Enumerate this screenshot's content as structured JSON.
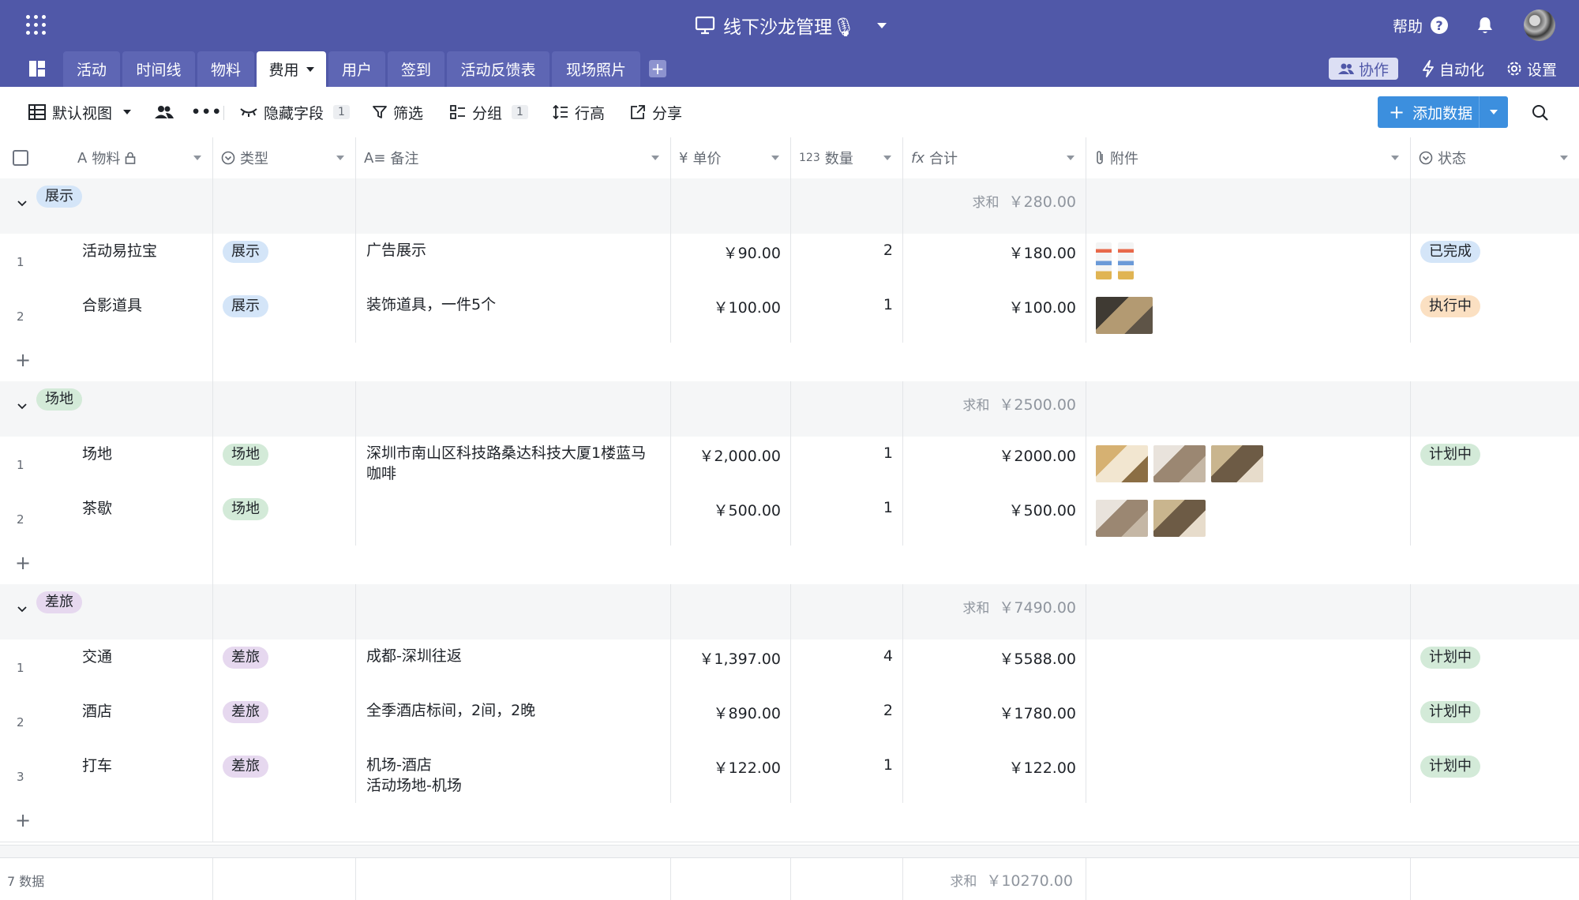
{
  "header": {
    "title": "线下沙龙管理🎙",
    "help_label": "帮助",
    "help_mark": "?"
  },
  "tabs": [
    {
      "label": "活动"
    },
    {
      "label": "时间线"
    },
    {
      "label": "物料"
    },
    {
      "label": "费用"
    },
    {
      "label": "用户"
    },
    {
      "label": "签到"
    },
    {
      "label": "活动反馈表"
    },
    {
      "label": "现场照片"
    }
  ],
  "active_tab": "费用",
  "tab_add_mark": "+",
  "right_tabs": {
    "collab": "协作",
    "automation": "自动化",
    "settings": "设置"
  },
  "toolbar": {
    "view": "默认视图",
    "hide_fields": "隐藏字段",
    "hide_count": "1",
    "filter": "筛选",
    "group": "分组",
    "group_count": "1",
    "row_height": "行高",
    "share": "分享",
    "add_data": "添加数据",
    "add_mark": "+"
  },
  "columns": [
    {
      "label": "物料"
    },
    {
      "label": "类型"
    },
    {
      "label": "备注"
    },
    {
      "label": "单价"
    },
    {
      "label": "数量"
    },
    {
      "label": "合计"
    },
    {
      "label": "附件"
    },
    {
      "label": "状态"
    }
  ],
  "column_icon_text": {
    "text": "A",
    "note": "A≡",
    "price": "¥",
    "qty": "123",
    "formula": "fx"
  },
  "sum_label": "求和",
  "add_row_mark": "+",
  "groups": [
    {
      "name": "展示",
      "color": "#d4e5f8",
      "sum": "￥280.00",
      "rows": [
        {
          "index": "1",
          "item": "活动易拉宝",
          "type": "展示",
          "note": [
            "广告展示"
          ],
          "price": "￥90.00",
          "qty": "2",
          "total": "￥180.00",
          "status": "已完成",
          "status_color": "#d4e5f8",
          "attachments": 2
        },
        {
          "index": "2",
          "item": "合影道具",
          "type": "展示",
          "note": [
            "装饰道具，一件5个"
          ],
          "price": "￥100.00",
          "qty": "1",
          "total": "￥100.00",
          "status": "执行中",
          "status_color": "#fbe0c2",
          "attachments": 1
        }
      ]
    },
    {
      "name": "场地",
      "color": "#d3ead8",
      "sum": "￥2500.00",
      "rows": [
        {
          "index": "1",
          "item": "场地",
          "type": "场地",
          "note": [
            "深圳市南山区科技路桑达科技大厦1楼蓝马",
            "咖啡"
          ],
          "price": "￥2,000.00",
          "qty": "1",
          "total": "￥2000.00",
          "status": "计划中",
          "status_color": "#d3ead8",
          "attachments": 3
        },
        {
          "index": "2",
          "item": "茶歇",
          "type": "场地",
          "note": [],
          "price": "￥500.00",
          "qty": "1",
          "total": "￥500.00",
          "status": "",
          "status_color": "",
          "attachments": 2
        }
      ]
    },
    {
      "name": "差旅",
      "color": "#e6d8ef",
      "sum": "￥7490.00",
      "rows": [
        {
          "index": "1",
          "item": "交通",
          "type": "差旅",
          "note": [
            "成都-深圳往返"
          ],
          "price": "￥1,397.00",
          "qty": "4",
          "total": "￥5588.00",
          "status": "计划中",
          "status_color": "#d3ead8",
          "attachments": 0
        },
        {
          "index": "2",
          "item": "酒店",
          "type": "差旅",
          "note": [
            "全季酒店标间，2间，2晚"
          ],
          "price": "￥890.00",
          "qty": "2",
          "total": "￥1780.00",
          "status": "计划中",
          "status_color": "#d3ead8",
          "attachments": 0
        },
        {
          "index": "3",
          "item": "打车",
          "type": "差旅",
          "note": [
            "机场-酒店",
            "活动场地-机场"
          ],
          "price": "￥122.00",
          "qty": "1",
          "total": "￥122.00",
          "status": "计划中",
          "status_color": "#d3ead8",
          "attachments": 0
        }
      ]
    }
  ],
  "footer": {
    "count": "7 数据",
    "sum_label": "求和",
    "sum": "￥10270.00"
  }
}
